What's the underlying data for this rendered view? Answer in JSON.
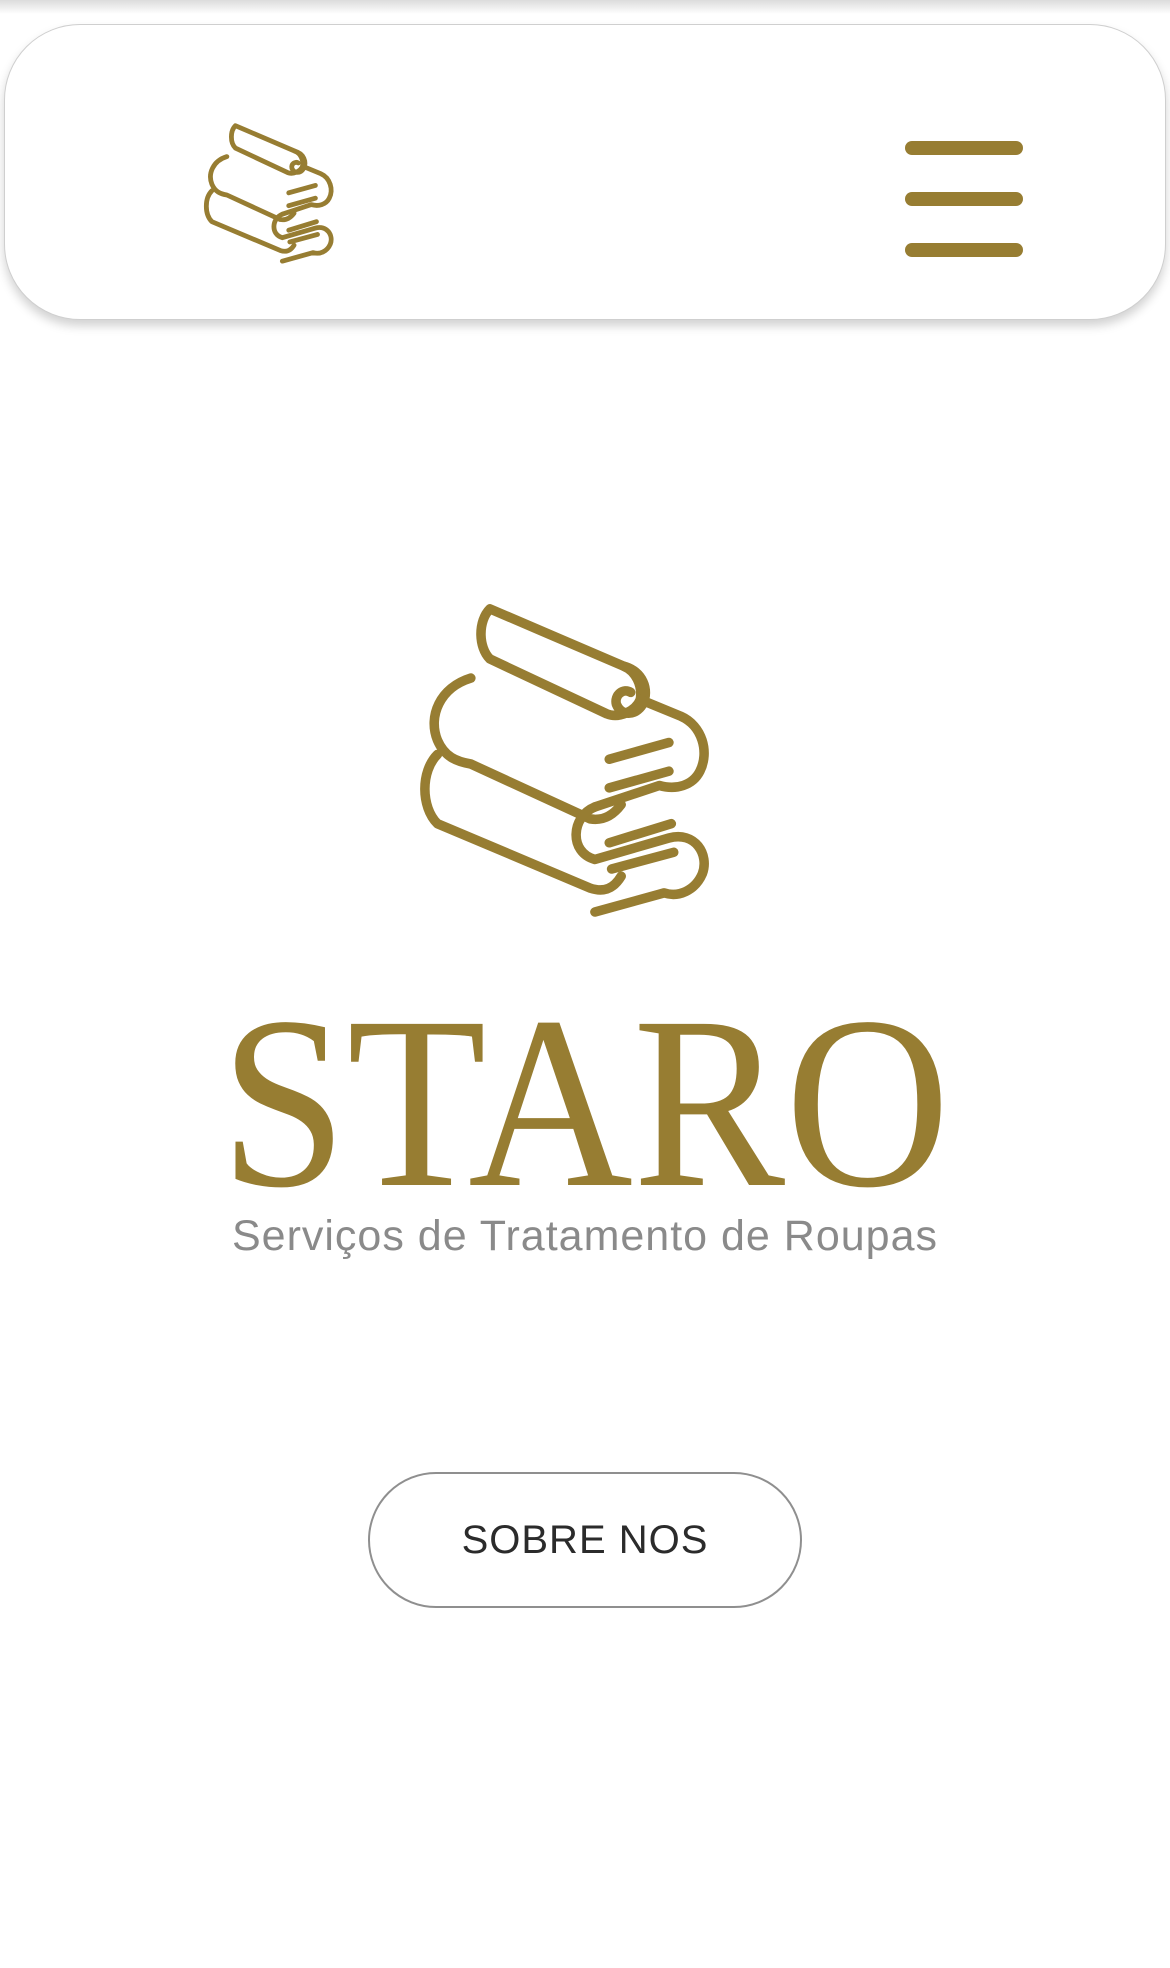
{
  "brand": {
    "name": "STARO",
    "tagline": "Serviços de Tratamento de Roupas",
    "logo_icon": "folded-towels-icon",
    "accent_color": "#977d32"
  },
  "header": {
    "menu_icon": "hamburger-menu-icon"
  },
  "hero": {
    "cta_label": "SOBRE NOS"
  }
}
